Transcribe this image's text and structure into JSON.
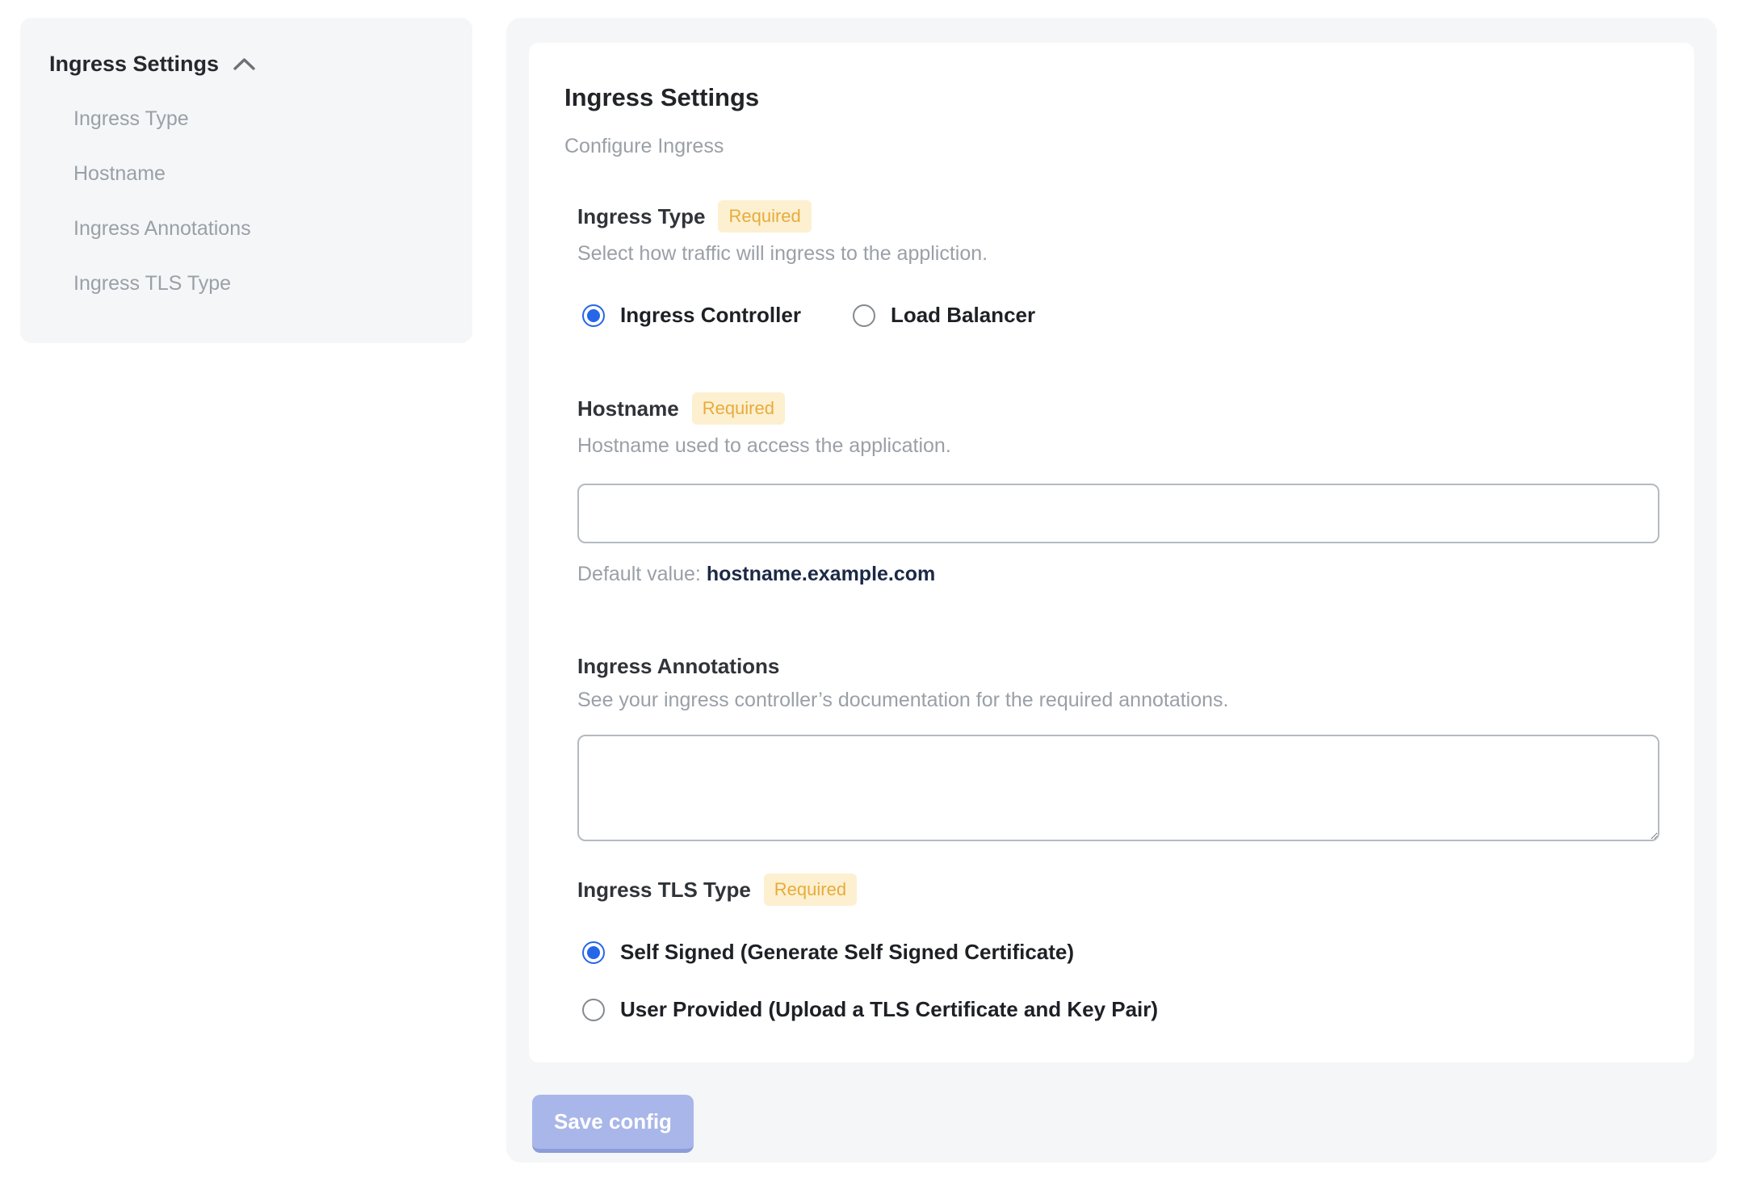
{
  "sidebar": {
    "header": "Ingress Settings",
    "items": [
      {
        "label": "Ingress Type"
      },
      {
        "label": "Hostname"
      },
      {
        "label": "Ingress Annotations"
      },
      {
        "label": "Ingress TLS Type"
      }
    ]
  },
  "panel": {
    "title": "Ingress Settings",
    "subtitle": "Configure Ingress",
    "required_badge": "Required",
    "sections": {
      "ingress_type": {
        "label": "Ingress Type",
        "help": "Select how traffic will ingress to the appliction.",
        "options": [
          {
            "label": "Ingress Controller",
            "selected": true
          },
          {
            "label": "Load Balancer",
            "selected": false
          }
        ]
      },
      "hostname": {
        "label": "Hostname",
        "help": "Hostname used to access the application.",
        "value": "",
        "default_prefix": "Default value: ",
        "default_value": "hostname.example.com"
      },
      "annotations": {
        "label": "Ingress Annotations",
        "help": "See your ingress controller’s documentation for the required annotations.",
        "value": ""
      },
      "tls": {
        "label": "Ingress TLS Type",
        "options": [
          {
            "label": "Self Signed (Generate Self Signed Certificate)",
            "selected": true
          },
          {
            "label": "User Provided (Upload a TLS Certificate and Key Pair)",
            "selected": false
          }
        ]
      }
    },
    "save_button": "Save config"
  },
  "colors": {
    "accent_blue": "#2666e8",
    "badge_bg": "#fcf0d0",
    "badge_text": "#e8ab3c",
    "panel_bg": "#f4f6f8",
    "save_button_bg": "#a9b6e9",
    "default_value_text": "#1b2947"
  }
}
